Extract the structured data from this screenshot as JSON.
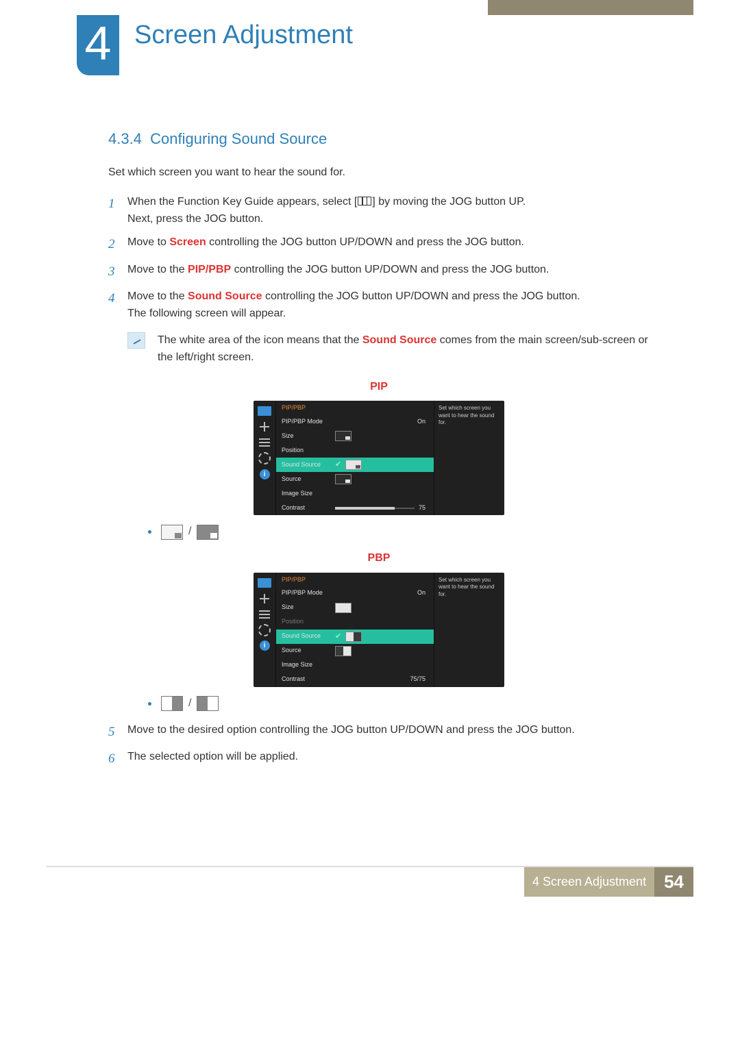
{
  "chapter": {
    "number": "4",
    "title": "Screen Adjustment"
  },
  "section": {
    "number": "4.3.4",
    "title": "Configuring Sound Source"
  },
  "intro": "Set which screen you want to hear the sound for.",
  "steps": {
    "s1a": "When the Function Key Guide appears, select [",
    "s1b": "] by moving the JOG button UP.",
    "s1c": "Next, press the JOG button.",
    "s2a": "Move to ",
    "s2kw": "Screen",
    "s2b": " controlling the JOG button UP/DOWN and press the JOG button.",
    "s3a": "Move to the ",
    "s3kw": "PIP/PBP",
    "s3b": " controlling the JOG button UP/DOWN and press the JOG button.",
    "s4a": "Move to the ",
    "s4kw": "Sound Source",
    "s4b": " controlling the JOG button UP/DOWN and press the JOG button.",
    "s4c": "The following screen will appear.",
    "s5": "Move to the desired option controlling the JOG button UP/DOWN and press the JOG button.",
    "s6": "The selected option will be applied."
  },
  "note": {
    "a": "The white area of the icon means that the ",
    "kw": "Sound Source",
    "b": " comes from the main screen/sub-screen or the left/right screen."
  },
  "osd": {
    "pip_label": "PIP",
    "pbp_label": "PBP",
    "title": "PIP/PBP",
    "desc": "Set which screen you want to hear the sound for.",
    "rows": {
      "mode": "PIP/PBP Mode",
      "size": "Size",
      "position": "Position",
      "sound": "Sound Source",
      "source": "Source",
      "image": "Image Size",
      "contrast": "Contrast"
    },
    "on": "On",
    "pip_contrast": "75",
    "pbp_contrast": "75/75",
    "info_i": "i"
  },
  "footer": {
    "label": "4 Screen Adjustment",
    "page": "54"
  }
}
